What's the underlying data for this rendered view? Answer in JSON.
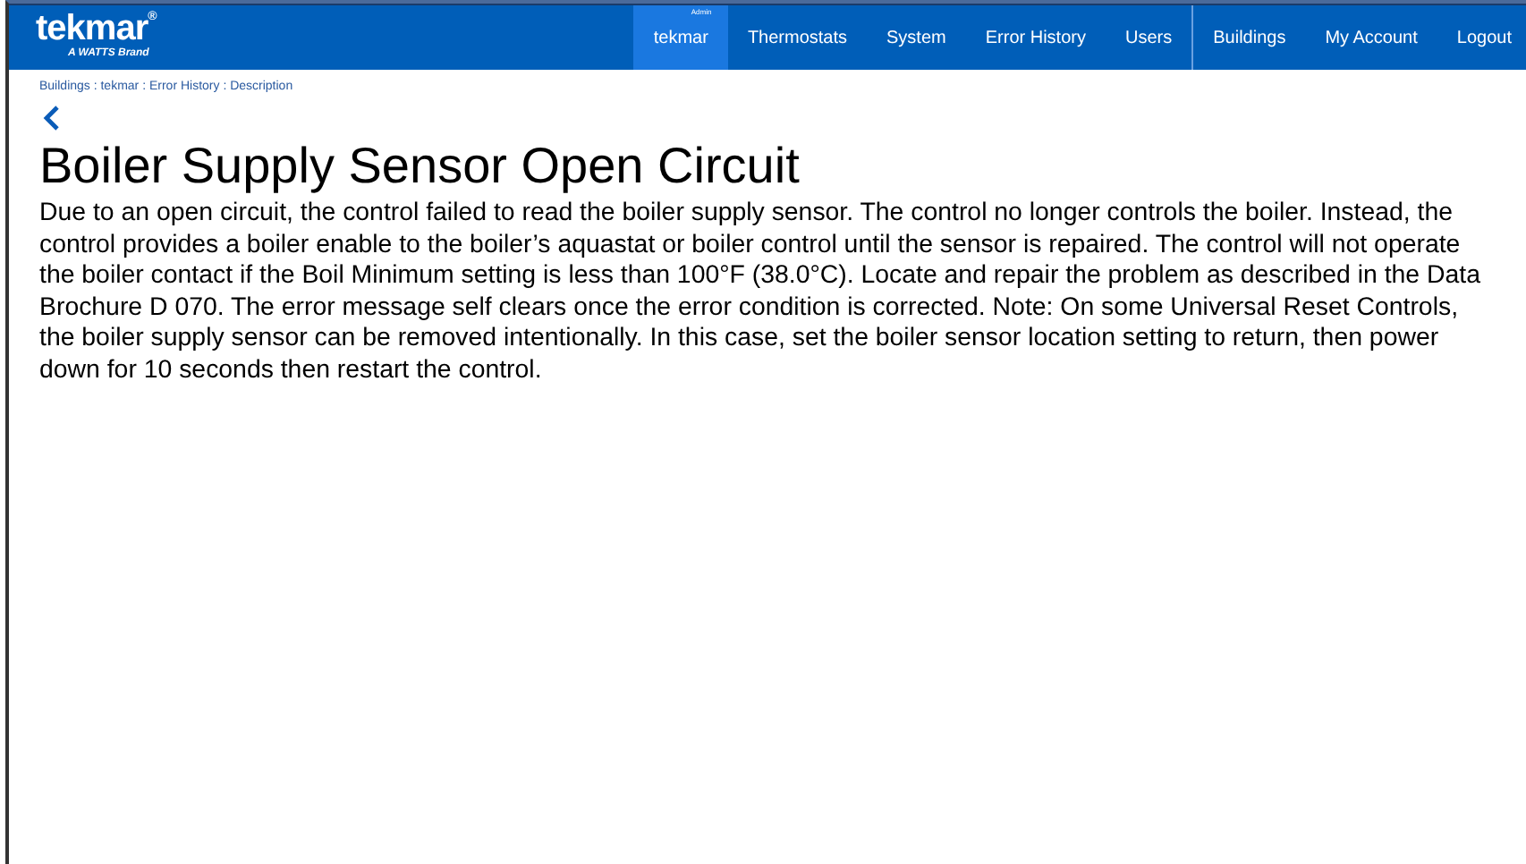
{
  "header": {
    "logo": "tekmar",
    "logo_mark": "®",
    "tagline": "A WATTS Brand",
    "nav": [
      {
        "label": "tekmar",
        "badge": "Admin",
        "selected": true
      },
      {
        "label": "Thermostats",
        "selected": false
      },
      {
        "label": "System",
        "selected": false
      },
      {
        "label": "Error History",
        "selected": false
      },
      {
        "label": "Users",
        "selected": false
      }
    ],
    "account_nav": [
      {
        "label": "Buildings",
        "selected": false
      },
      {
        "label": "My Account",
        "selected": false
      },
      {
        "label": "Logout",
        "selected": false
      }
    ]
  },
  "breadcrumb": "Buildings : tekmar : Error History : Description",
  "title": "Boiler Supply Sensor Open Circuit",
  "description": "Due to an open circuit, the control failed to read the boiler supply sensor. The control no longer controls the boiler. Instead, the control provides a boiler enable to the boiler’s aquastat or boiler control until the sensor is repaired. The control will not operate the boiler contact if the Boil Minimum setting is less than 100°F (38.0°C). Locate and repair the problem as described in the Data Brochure D 070. The error message self clears once the error condition is corrected. Note: On some Universal Reset Controls, the boiler supply sensor can be removed intentionally. In this case, set the boiler sensor location setting to return, then power down for 10 seconds then restart the control."
}
